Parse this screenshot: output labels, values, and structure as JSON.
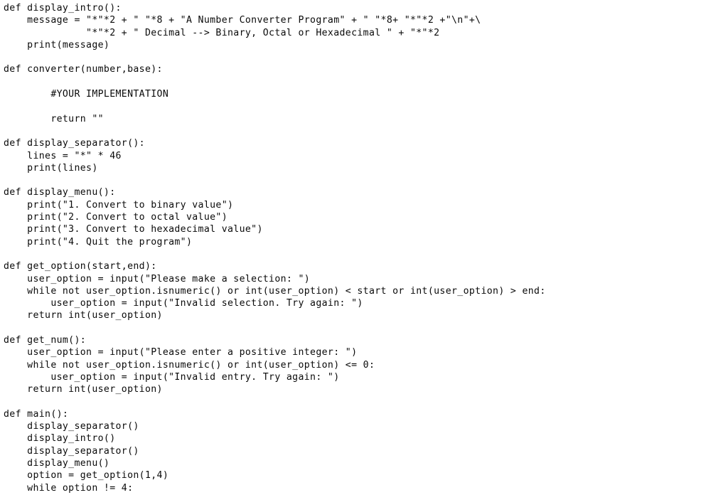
{
  "document": {
    "kind": "source-code-screenshot",
    "language": "Python",
    "background_color": "#ffffff",
    "text_color": "#0a0a0a",
    "font_style": "monospace",
    "lines": [
      "def display_intro():",
      "    message = \"*\"*2 + \" \"*8 + \"A Number Converter Program\" + \" \"*8+ \"*\"*2 +\"\\n\"+\\",
      "              \"*\"*2 + \" Decimal --> Binary, Octal or Hexadecimal \" + \"*\"*2",
      "    print(message)",
      "",
      "def converter(number,base):",
      "",
      "        #YOUR IMPLEMENTATION",
      "",
      "        return \"\"",
      "",
      "def display_separator():",
      "    lines = \"*\" * 46",
      "    print(lines)",
      "",
      "def display_menu():",
      "    print(\"1. Convert to binary value\")",
      "    print(\"2. Convert to octal value\")",
      "    print(\"3. Convert to hexadecimal value\")",
      "    print(\"4. Quit the program\")",
      "",
      "def get_option(start,end):",
      "    user_option = input(\"Please make a selection: \")",
      "    while not user_option.isnumeric() or int(user_option) < start or int(user_option) > end:",
      "        user_option = input(\"Invalid selection. Try again: \")",
      "    return int(user_option)",
      "",
      "def get_num():",
      "    user_option = input(\"Please enter a positive integer: \")",
      "    while not user_option.isnumeric() or int(user_option) <= 0:",
      "        user_option = input(\"Invalid entry. Try again: \")",
      "    return int(user_option)",
      "",
      "def main():",
      "    display_separator()",
      "    display_intro()",
      "    display_separator()",
      "    display_menu()",
      "    option = get_option(1,4)",
      "    while option != 4:"
    ]
  }
}
